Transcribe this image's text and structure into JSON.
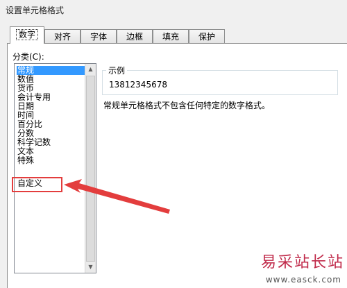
{
  "window": {
    "title": "设置单元格格式"
  },
  "tabs": [
    {
      "label": "数字",
      "active": true
    },
    {
      "label": "对齐",
      "active": false
    },
    {
      "label": "字体",
      "active": false
    },
    {
      "label": "边框",
      "active": false
    },
    {
      "label": "填充",
      "active": false
    },
    {
      "label": "保护",
      "active": false
    }
  ],
  "category": {
    "label": "分类(C):",
    "items": [
      "常规",
      "数值",
      "货币",
      "会计专用",
      "日期",
      "时间",
      "百分比",
      "分数",
      "科学记数",
      "文本",
      "特殊",
      "自定义"
    ],
    "selected": "常规"
  },
  "sample": {
    "legend": "示例",
    "value": "13812345678"
  },
  "description": "常规单元格格式不包含任何特定的数字格式。",
  "annotation": {
    "color": "#e33d3d"
  },
  "watermark": {
    "cn": "易采站长站",
    "url": "www.easck.com"
  }
}
